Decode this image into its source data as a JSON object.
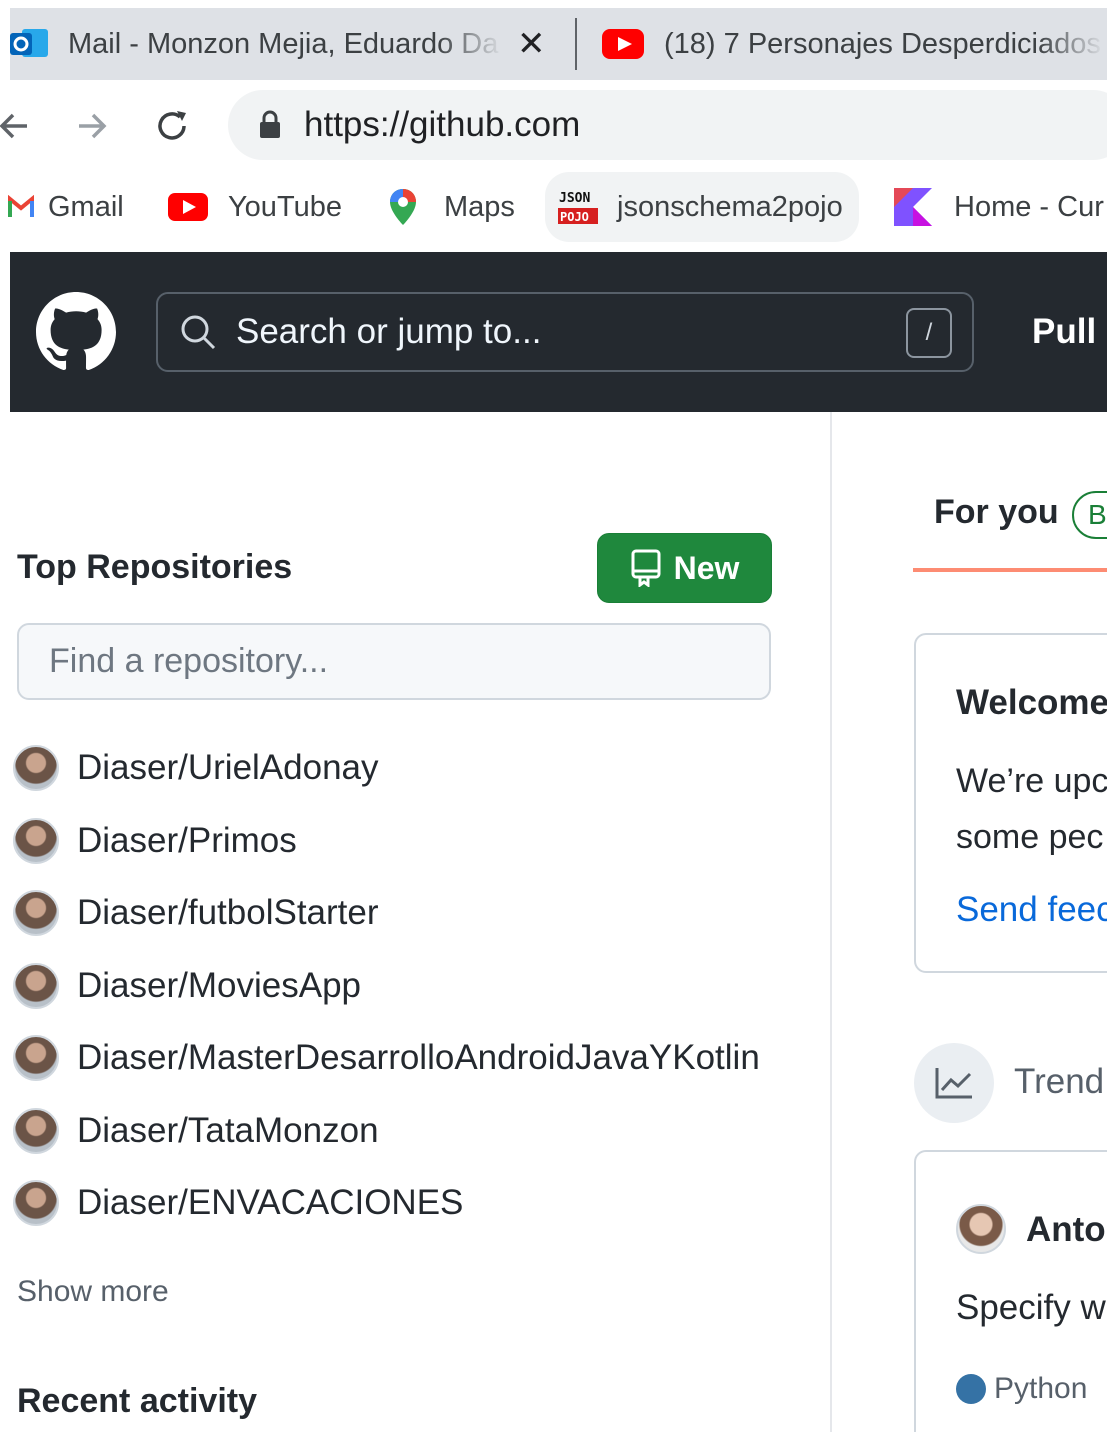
{
  "browser": {
    "tabs": [
      {
        "title": "Mail - Monzon Mejia, Eduardo Da",
        "close": "✕"
      },
      {
        "title": "(18) 7 Personajes Desperdiciados"
      }
    ],
    "url": "https://github.com",
    "bookmarks": [
      {
        "label": "Gmail"
      },
      {
        "label": "YouTube"
      },
      {
        "label": "Maps"
      },
      {
        "label": "jsonschema2pojo"
      },
      {
        "label": "Home - Cur"
      }
    ]
  },
  "header": {
    "search_placeholder": "Search or jump to...",
    "search_shortcut": "/",
    "nav_pull": "Pull"
  },
  "sidebar": {
    "title": "Top Repositories",
    "new_button": "New",
    "find_placeholder": "Find a repository...",
    "repos": [
      {
        "name": "Diaser/UrielAdonay"
      },
      {
        "name": "Diaser/Primos"
      },
      {
        "name": "Diaser/futbolStarter"
      },
      {
        "name": "Diaser/MoviesApp"
      },
      {
        "name": "Diaser/MasterDesarrolloAndroidJavaYKotlin"
      },
      {
        "name": "Diaser/TataMonzon"
      },
      {
        "name": "Diaser/ENVACACIONES"
      }
    ],
    "show_more": "Show more",
    "recent_activity": "Recent activity"
  },
  "feed": {
    "tab": "For you",
    "badge": "B",
    "welcome": {
      "title": "Welcome",
      "line1": "We’re upc",
      "line2": "some pec",
      "link": "Send feec"
    },
    "trending_label": "Trend",
    "card": {
      "user": "Anto",
      "description": "Specify w",
      "language": "Python",
      "language_color": "#3572A5"
    }
  },
  "colors": {
    "header_bg": "#24292f",
    "primary_button": "#1f883d",
    "link": "#0969da",
    "tab_underline": "#fd8c73"
  }
}
